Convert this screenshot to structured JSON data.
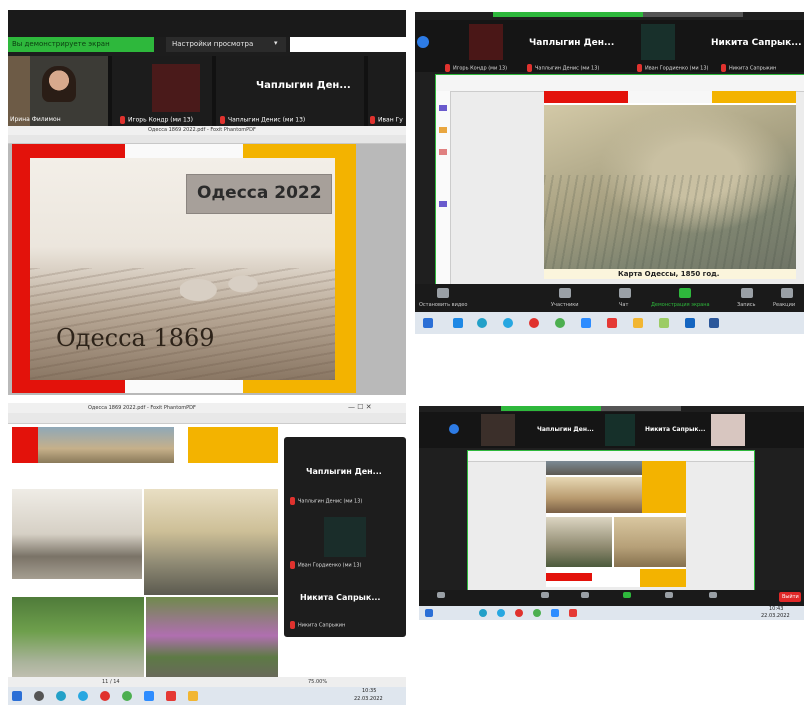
{
  "q1": {
    "share_banner": "Вы демонстрируете экран",
    "view_options": "Настройки просмотра",
    "window_title": "Одесса 1869 2022.pdf - Foxit PhantomPDF",
    "participants": [
      {
        "name": "Ирина Филимон"
      },
      {
        "name": "Игорь Кондр (ми 13)"
      },
      {
        "name": "Чаплыгин Денис (ми 13)"
      },
      {
        "name": "Иван Гу"
      }
    ],
    "speaker_name": "Чаплыгин Ден...",
    "slide_title": "Одесса  2022",
    "photo_caption": "Одесса 1869"
  },
  "q2": {
    "participants_top": [
      {
        "name": "Чаплыгин Ден..."
      },
      {
        "name": "Никита Сапрык..."
      }
    ],
    "participants_sub": [
      {
        "name": "Игорь Кондр (ми 13)"
      },
      {
        "name": "Чаплыгин Денис (ми 13)"
      },
      {
        "name": "Иван Гордиенко (ми 13)"
      },
      {
        "name": "Никита Сапрыкин"
      }
    ],
    "caption": "Карта Одессы, 1850 год.",
    "controls": [
      {
        "label": "Остановить видео"
      },
      {
        "label": "Участники"
      },
      {
        "label": "Чат"
      },
      {
        "label": "Демонстрация экрана"
      },
      {
        "label": "Запись"
      },
      {
        "label": "Реакции"
      }
    ]
  },
  "q3": {
    "window_title": "Одесса 1869 2022.pdf - Foxit PhantomPDF",
    "participants": [
      {
        "name": "Чаплыгин Ден...",
        "sub": "Чаплыгин Денис (ми 13)"
      },
      {
        "name": "Иван Гордиенко (ми 13)",
        "sub": ""
      },
      {
        "name": "Никита Сапрык...",
        "sub": "Никита Сапрыкин"
      }
    ],
    "page_indicator": "11 / 14",
    "zoom": "75.00%",
    "time": "10:35",
    "date": "22.03.2022"
  },
  "q4": {
    "participants": [
      {
        "name": "Чаплыгин Ден..."
      },
      {
        "name": "Никита Сапрык..."
      }
    ],
    "end_button": "Выйти",
    "time": "10:43",
    "date": "22.03.2022"
  },
  "colors": {
    "red": "#e3120b",
    "yellow": "#f3b300",
    "zoom_dark": "#1f1f1f",
    "green": "#2eb83c",
    "taskbar": "#dfe6ee"
  }
}
